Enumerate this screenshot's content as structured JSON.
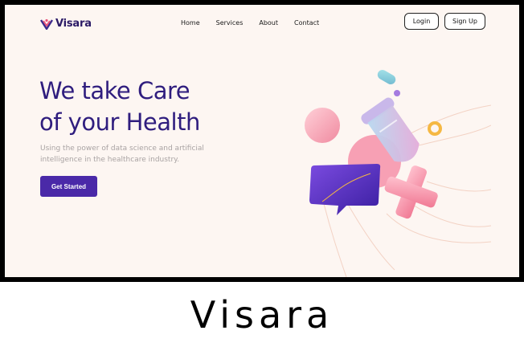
{
  "brand": {
    "name": "Visara",
    "accent": "#4a29a8",
    "title_color": "#2f1d7e",
    "logo_colors": [
      "#e8547a",
      "#3b2a8c"
    ]
  },
  "nav": {
    "items": [
      "Home",
      "Services",
      "About",
      "Contact"
    ]
  },
  "auth": {
    "login_label": "Login",
    "signup_label": "Sign Up"
  },
  "hero": {
    "title_line1": "We take Care",
    "title_line2": "of your Health",
    "subtitle": "Using the power of data science and artificial intelligence in the healthcare industry.",
    "cta_label": "Get Started"
  },
  "illustration": {
    "icon": "healthcare-3d-illustration"
  },
  "caption": "Visara"
}
